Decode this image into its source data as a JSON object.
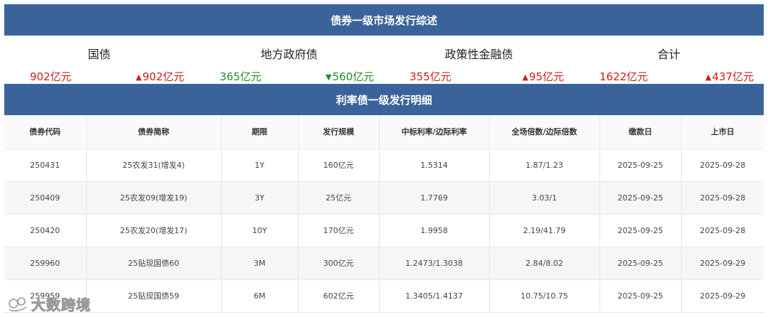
{
  "banner1": "债券一级市场发行综述",
  "banner2": "利率债一级发行明细",
  "summary": [
    {
      "title": "国债",
      "amount": "902亿元",
      "change": "902亿元",
      "direction": "up"
    },
    {
      "title": "地方政府债",
      "amount": "365亿元",
      "change": "560亿元",
      "direction": "down"
    },
    {
      "title": "政策性金融债",
      "amount": "355亿元",
      "change": "95亿元",
      "direction": "up"
    },
    {
      "title": "合计",
      "amount": "1622亿元",
      "change": "437亿元",
      "direction": "up"
    }
  ],
  "colors": {
    "banner": "#3a639b",
    "up": "#c8201f",
    "down": "#1e8c28"
  },
  "table": {
    "headers": [
      "债券代码",
      "债券简称",
      "期限",
      "发行规模",
      "中标利率/边际利率",
      "全场倍数/边际倍数",
      "缴款日",
      "上市日"
    ],
    "rows": [
      [
        "250431",
        "25农发31(增发4)",
        "1Y",
        "160亿元",
        "1.5314",
        "1.87/1.23",
        "2025-09-25",
        "2025-09-28"
      ],
      [
        "250409",
        "25农发09(增发19)",
        "3Y",
        "25亿元",
        "1.7769",
        "3.03/1",
        "2025-09-25",
        "2025-09-28"
      ],
      [
        "250420",
        "25农发20(增发17)",
        "10Y",
        "170亿元",
        "1.9958",
        "2.19/41.79",
        "2025-09-25",
        "2025-09-28"
      ],
      [
        "259960",
        "25贴现国债60",
        "3M",
        "300亿元",
        "1.2473/1.3038",
        "2.84/8.02",
        "2025-09-25",
        "2025-09-29"
      ],
      [
        "259959",
        "25贴现国债59",
        "6M",
        "602亿元",
        "1.3405/1.4137",
        "10.75/10.75",
        "2025-09-25",
        "2025-09-29"
      ]
    ]
  },
  "watermark": "大数跨境"
}
